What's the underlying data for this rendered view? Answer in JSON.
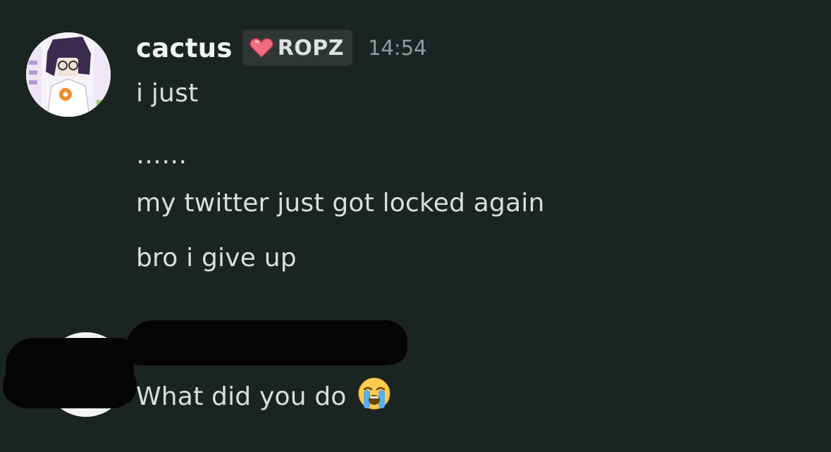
{
  "messages": [
    {
      "author": "cactus",
      "tag": "ROPZ",
      "timestamp": "14:54",
      "lines": [
        "i just",
        "……",
        "my twitter just got locked again",
        "bro i give up"
      ]
    },
    {
      "author": "",
      "lines": [
        "What did you do"
      ],
      "emoji": "loudly-crying-face"
    }
  ],
  "colors": {
    "background": "#1c2422",
    "username": "#f2f3f5",
    "message_text": "#dbdee1",
    "timestamp": "#949ba4",
    "tag_background": "#2f3634",
    "heart": "#f36b7f"
  }
}
